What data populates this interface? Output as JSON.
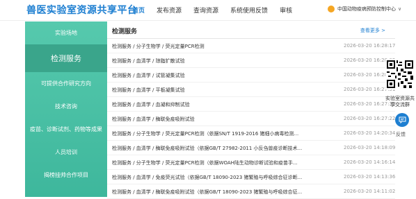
{
  "header": {
    "logo": "兽医实验室资源共享平台",
    "nav": [
      "首页",
      "发布资源",
      "查询资源",
      "系统使用反馈",
      "审核"
    ],
    "user": "中国动物疫病预防控制中心",
    "user_caret": "∨"
  },
  "sidebar": {
    "items": [
      "实验场地",
      "检测服务",
      "可提供合作研究方向",
      "技术咨询",
      "疫苗、诊断试剂、药物等成果",
      "人员培训",
      "揭榜挂帅合作项目"
    ]
  },
  "main": {
    "title": "检测服务",
    "more": "查看更多 >",
    "rows": [
      {
        "text": "检测服务 / 分子生物学 / 荧光定量PCR检测",
        "date": "2026-03-20 16:28:17"
      },
      {
        "text": "检测服务 / 血清学 / 琼脂扩散试验",
        "date": "2026-03-20 16:28:02"
      },
      {
        "text": "检测服务 / 血清学 / 试管凝集试验",
        "date": "2026-03-20 16:28:01"
      },
      {
        "text": "检测服务 / 血清学 / 平板凝集试验",
        "date": "2026-03-20 16:27:51"
      },
      {
        "text": "检测服务 / 血清学 / 血凝和抑制试验",
        "date": "2026-03-20 16:27:30"
      },
      {
        "text": "检测服务 / 血清学 / 酶联免疫吸附试验",
        "date": "2026-03-20 16:27:22"
      },
      {
        "text": "检测服务 / 分子生物学 / 荧光定量PCR检测（依据SN/T 1919-2016 猪细小病毒检测...",
        "date": "2026-03-20 14:20:34"
      },
      {
        "text": "检测服务 / 血清学 / 酶联免疫吸附试验（依据GB/T 27982-2011 小反刍兽疫诊断技术...",
        "date": "2026-03-20 14:18:09"
      },
      {
        "text": "检测服务 / 分子生物学 / 荧光定量PCR检测（依据WOAH陆生动物诊断试验和疫苗手...",
        "date": "2026-03-20 14:16:14"
      },
      {
        "text": "检测服务 / 血清学 / 免疫荧光试验（依据GB/T 18090-2023 猪繁殖与呼吸综合征诊断...",
        "date": "2026-03-20 14:13:36"
      },
      {
        "text": "检测服务 / 血清学 / 酶联免疫吸附试验（依据GB/T 18090-2023 猪繁殖与呼吸综合征...",
        "date": "2026-03-20 14:11:02"
      }
    ]
  },
  "float": {
    "qr_label": "实验室资源共享交流群",
    "feedback_label": "反馈"
  },
  "colors": {
    "brand": "#1e7fd1",
    "sidebar": "#48bfa3",
    "user_icon": "#f5a623"
  }
}
